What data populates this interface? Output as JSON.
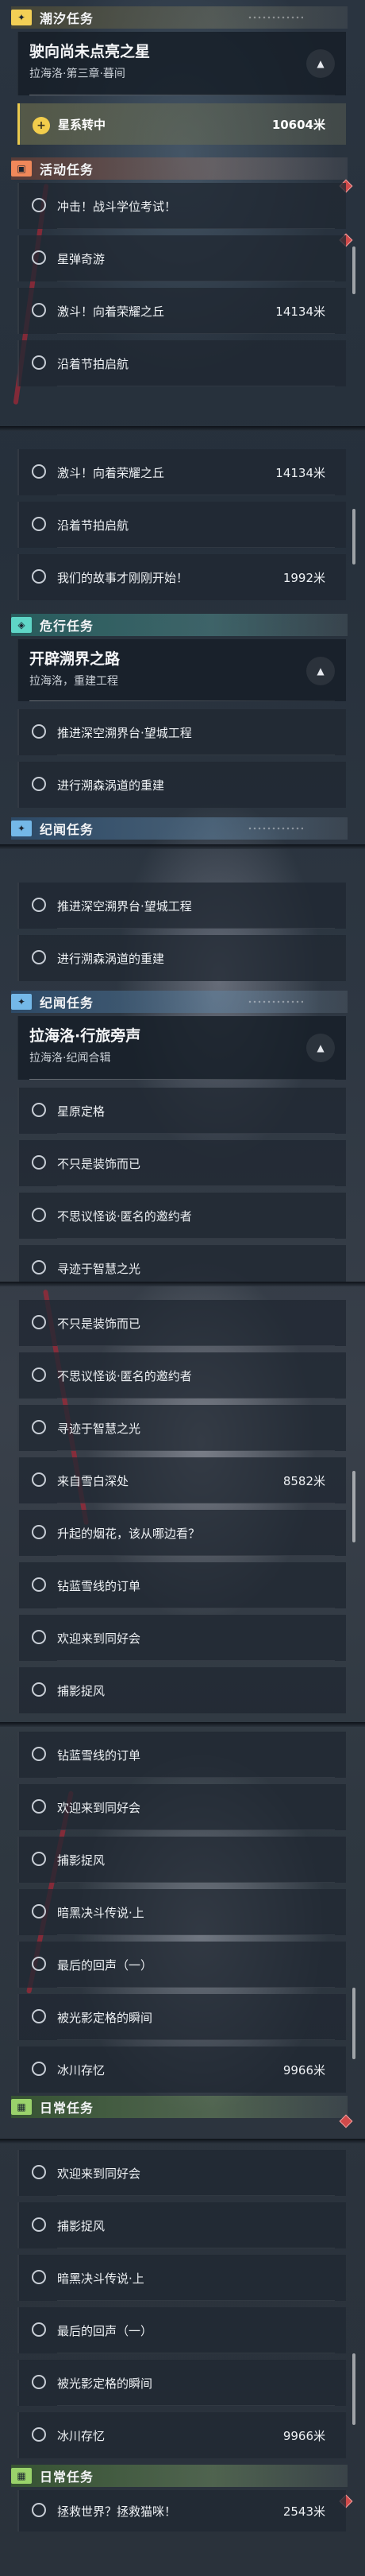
{
  "categories": {
    "tide": "潮汐任务",
    "activity": "活动任务",
    "danger": "危行任务",
    "chronicle": "纪闻任务",
    "daily": "日常任务"
  },
  "quests": {
    "main_title": "驶向尚未点亮之星",
    "main_sub": "拉海洛·第三章·暮间",
    "tracking_label": "星系转中",
    "tracking_distance": "10604米",
    "danger_title": "开辟溯界之路",
    "danger_sub": "拉海洛，重建工程",
    "chronicle_title": "拉海洛·行旅旁声",
    "chronicle_sub": "拉海洛·纪闻合辑"
  },
  "items": {
    "charge": "冲击！战斗学位考试！",
    "star": "星弹奇游",
    "glory": "激斗！向着荣耀之丘",
    "glory_dist": "14134米",
    "festival": "沿着节拍启航",
    "story": "我们的故事才刚刚开始！",
    "story_dist": "1992米",
    "deepsea": "推进深空溯界台·望城工程",
    "swamp": "进行溯森涡道的重建",
    "star_scale": "星原定格",
    "decor": "不只是装饰而已",
    "mystery": "不思议怪谈·匿名的邀约者",
    "wisdom": "寻迹于智慧之光",
    "snow": "来自雪白深处",
    "snow_dist": "8582米",
    "smoke": "升起的烟花，该从哪边看？",
    "order": "钻蓝雪线的订单",
    "welcome": "欢迎来到同好会",
    "catch": "捕影捉风",
    "duel": "暗黑决斗传说·上",
    "finale": "最后的回声（一）",
    "moment": "被光影定格的瞬间",
    "ice": "冰川存忆",
    "ice_dist": "9966米",
    "catnip": "拯救世界？拯救猫咪！",
    "catnip_dist": "2543米"
  },
  "icons": {
    "tide": "sparkle-icon",
    "activity": "ticket-icon",
    "danger": "shield-icon",
    "chronicle": "compass-icon",
    "daily": "calendar-icon"
  },
  "colors": {
    "tide": "#f3cf55",
    "activity": "#f0885a",
    "danger": "#5fd6c7",
    "chronicle": "#74b8e8",
    "daily": "#9ad26b"
  }
}
